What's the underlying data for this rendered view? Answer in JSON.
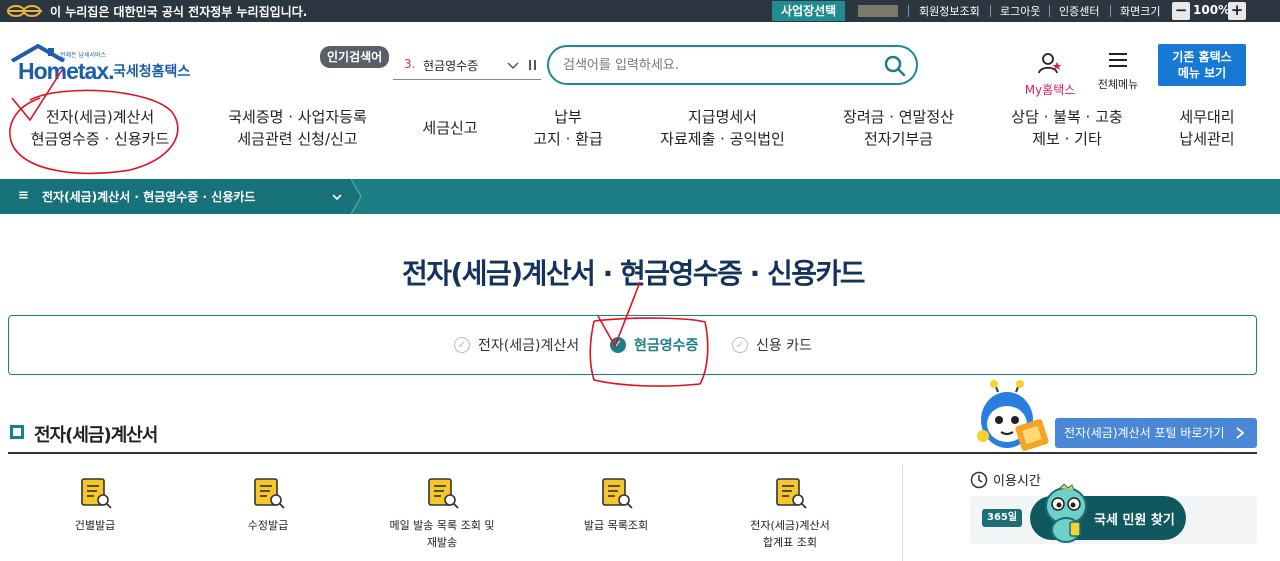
{
  "gov_bar": {
    "notice": "이 누리집은 대한민국 공식 전자정부 누리집입니다.",
    "business_select": "사업장선택",
    "links": [
      "회원정보조회",
      "로그아웃",
      "인증센터",
      "화면크기"
    ],
    "zoom_minus": "−",
    "zoom_value": "100%",
    "zoom_plus": "+"
  },
  "header": {
    "logo_text": "Hometax.",
    "logo_tagline": "언제든 납세서비스",
    "logo_org": "국세청홈택스",
    "popular_label": "인기검색어",
    "rank_number": "3.",
    "rank_keyword": "현금영수증",
    "search_placeholder": "검색어를 입력하세요.",
    "my_hometax": "My홈택스",
    "all_menu": "전체메뉴",
    "old_menu_line1": "기존 홈택스",
    "old_menu_line2": "메뉴 보기"
  },
  "gnb": [
    {
      "line1": "전자(세금)계산서",
      "line2": "현금영수증 · 신용카드"
    },
    {
      "line1": "국세증명 · 사업자등록",
      "line2": "세금관련 신청/신고"
    },
    {
      "line1": "세금신고",
      "line2": ""
    },
    {
      "line1": "납부",
      "line2": "고지 · 환급"
    },
    {
      "line1": "지급명세서",
      "line2": "자료제출 · 공익법인"
    },
    {
      "line1": "장려금 · 연말정산",
      "line2": "전자기부금"
    },
    {
      "line1": "상담 · 불복 · 고충",
      "line2": "제보 · 기타"
    },
    {
      "line1": "세무대리",
      "line2": "납세관리"
    }
  ],
  "breadcrumb": {
    "menu_icon": "≡",
    "current": "전자(세금)계산서 · 현금영수증 · 신용카드"
  },
  "page_title": "전자(세금)계산서 · 현금영수증 · 신용카드",
  "tabs": [
    {
      "label": "전자(세금)계산서",
      "active": false
    },
    {
      "label": "현금영수증",
      "active": true
    },
    {
      "label": "신용 카드",
      "active": false
    }
  ],
  "section": {
    "title": "전자(세금)계산서",
    "portal_button": "전자(세금)계산서 포털 바로가기"
  },
  "services": [
    {
      "line1": "건별발급",
      "line2": ""
    },
    {
      "line1": "수정발급",
      "line2": ""
    },
    {
      "line1": "메일 발송 목록 조회 및",
      "line2": "재발송"
    },
    {
      "line1": "발급 목록조회",
      "line2": ""
    },
    {
      "line1": "전자(세금)계산서",
      "line2": "합계표 조회"
    }
  ],
  "usage": {
    "title": "이용시간",
    "badge": "365일"
  },
  "civil_button": "국세 민원 찾기",
  "colors": {
    "teal": "#1c7f86",
    "navy_title": "#13335c",
    "blue_button": "#1779d4",
    "annotation_red": "#e0121e"
  }
}
